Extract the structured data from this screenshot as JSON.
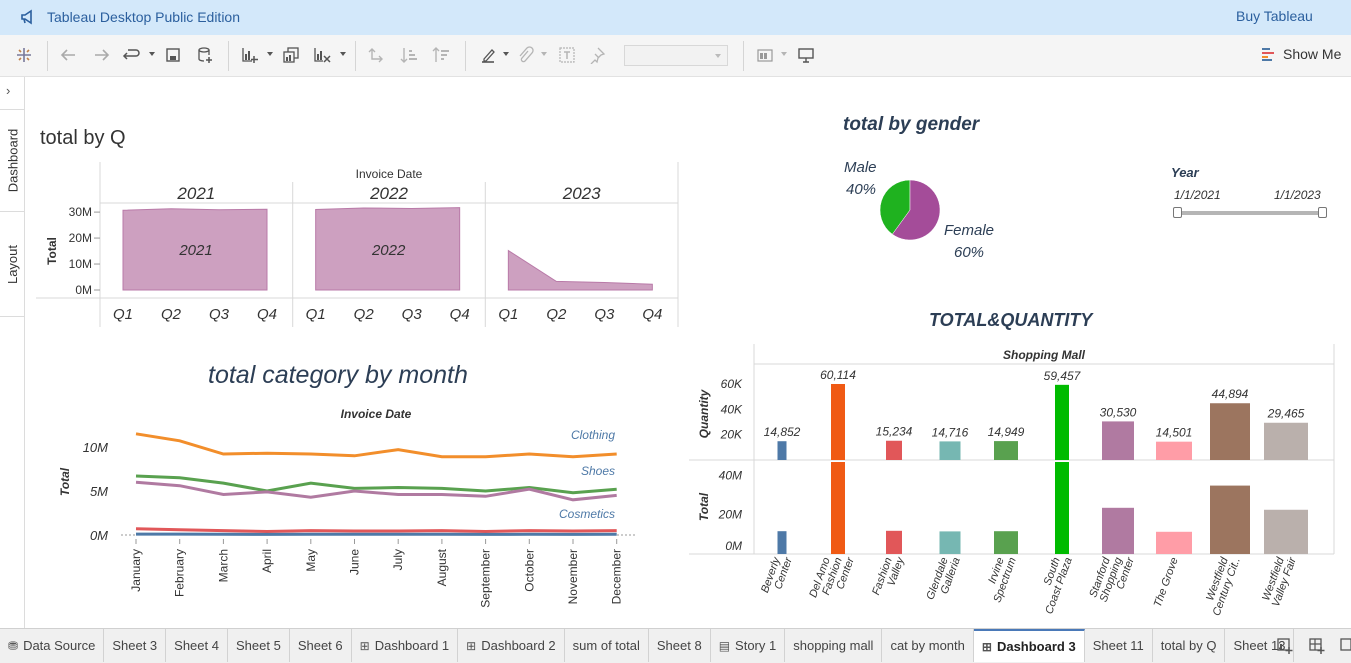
{
  "app": {
    "title": "Tableau Desktop Public Edition",
    "buy_label": "Buy Tableau"
  },
  "toolbar": {
    "show_me_label": "Show Me"
  },
  "side_panel": {
    "dashboard_label": "Dashboard",
    "layout_label": "Layout"
  },
  "sheets": {
    "total_by_q": {
      "title": "total by Q",
      "header": "Invoice Date",
      "ylabel": "Total",
      "panes": [
        "2021",
        "2022",
        "2023"
      ],
      "y_ticks": [
        "30M",
        "20M",
        "10M",
        "0M"
      ],
      "quarters": [
        "Q1",
        "Q2",
        "Q3",
        "Q4"
      ]
    },
    "gender": {
      "title": "total by gender",
      "male_label": "Male",
      "male_pct": "40%",
      "female_label": "Female",
      "female_pct": "60%"
    },
    "year_filter": {
      "title": "Year",
      "start": "1/1/2021",
      "end": "1/1/2023"
    },
    "category_month": {
      "title": "total category by month",
      "header": "Invoice Date",
      "ylabel": "Total",
      "y_ticks": [
        "10M",
        "5M",
        "0M"
      ]
    },
    "total_quantity": {
      "title": "TOTAL&QUANTITY",
      "header": "Shopping Mall",
      "quantity_label": "Quantity",
      "total_label": "Total",
      "qty_ticks": [
        "60K",
        "40K",
        "20K"
      ],
      "total_ticks": [
        "40M",
        "20M",
        "0M"
      ]
    }
  },
  "chart_data": [
    {
      "type": "area",
      "title": "total by Q",
      "ylabel": "Total",
      "xlabel": "Invoice Date",
      "ylim": [
        0,
        33000000
      ],
      "categories": [
        "Q1",
        "Q2",
        "Q3",
        "Q4"
      ],
      "series": [
        {
          "name": "2021",
          "color": "#c48fb5",
          "values": [
            30700000,
            31300000,
            30900000,
            31100000
          ]
        },
        {
          "name": "2022",
          "color": "#c48fb5",
          "values": [
            31000000,
            31600000,
            31400000,
            31700000
          ]
        },
        {
          "name": "2023",
          "color": "#c48fb5",
          "values": [
            15200000,
            3300000,
            2900000,
            2200000
          ]
        }
      ]
    },
    {
      "type": "pie",
      "title": "total by gender",
      "categories": [
        "Male",
        "Female"
      ],
      "values": [
        40,
        60
      ],
      "colors": [
        "#1fb21f",
        "#a44c99"
      ]
    },
    {
      "type": "line",
      "title": "total category by month",
      "xlabel": "Invoice Date",
      "ylabel": "Total",
      "ylim": [
        -300000,
        12200000
      ],
      "categories": [
        "January",
        "February",
        "March",
        "April",
        "May",
        "June",
        "July",
        "August",
        "September",
        "October",
        "November",
        "December"
      ],
      "series": [
        {
          "name": "Clothing",
          "color": "#f28e2b",
          "values": [
            11500000,
            10700000,
            9200000,
            9300000,
            9200000,
            9000000,
            9700000,
            8900000,
            8900000,
            9200000,
            8900000,
            9200000
          ]
        },
        {
          "name": "Shoes",
          "color": "#59a14f",
          "values": [
            6700000,
            6500000,
            5900000,
            5000000,
            5900000,
            5300000,
            5400000,
            5300000,
            5000000,
            5400000,
            4800000,
            5200000
          ]
        },
        {
          "name": "",
          "color": "#b07aa1",
          "values": [
            6000000,
            5600000,
            4600000,
            4900000,
            4300000,
            5000000,
            4600000,
            4600000,
            4400000,
            5200000,
            4000000,
            4500000
          ]
        },
        {
          "name": "Cosmetics",
          "color": "#e15759",
          "values": [
            700000,
            600000,
            500000,
            400000,
            500000,
            450000,
            450000,
            500000,
            400000,
            500000,
            450000,
            500000
          ]
        },
        {
          "name": "",
          "color": "#4e79a7",
          "values": [
            100000,
            100000,
            80000,
            70000,
            80000,
            80000,
            80000,
            80000,
            70000,
            80000,
            70000,
            80000
          ]
        }
      ]
    },
    {
      "type": "bar",
      "title": "TOTAL&QUANTITY",
      "xlabel": "Shopping Mall",
      "categories": [
        "Beverly Center",
        "Del Amo Fashion Center",
        "Fashion Valley",
        "Glendale Galleria",
        "Irvine Spectrum",
        "South Coast Plaza",
        "Stanford Shopping Center",
        "The Grove",
        "Westfield Century Cit..",
        "Westfield Valley Fair"
      ],
      "colors": [
        "#4e79a7",
        "#f05a14",
        "#e15759",
        "#76b7b2",
        "#59a14f",
        "#00bb00",
        "#b07aa1",
        "#ff9da7",
        "#9c755f",
        "#bab0ac"
      ],
      "series": [
        {
          "name": "Quantity",
          "values": [
            14852,
            60114,
            15234,
            14716,
            14949,
            59457,
            30530,
            14501,
            44894,
            29465
          ],
          "labels": [
            "14,852",
            "60,114",
            "15,234",
            "14,716",
            "14,949",
            "59,457",
            "30,530",
            "14,501",
            "44,894",
            "29,465"
          ],
          "ylim": [
            0,
            65000
          ]
        },
        {
          "name": "Total",
          "values": [
            11600000,
            46800000,
            11800000,
            11500000,
            11600000,
            46800000,
            23500000,
            11300000,
            34800000,
            22500000
          ],
          "ylim": [
            0,
            47000000
          ]
        }
      ]
    }
  ],
  "tabs": [
    {
      "label": "Data Source",
      "icon": "database-icon"
    },
    {
      "label": "Sheet 3"
    },
    {
      "label": "Sheet 4"
    },
    {
      "label": "Sheet 5"
    },
    {
      "label": "Sheet 6"
    },
    {
      "label": "Dashboard 1",
      "icon": "dashboard-icon"
    },
    {
      "label": "Dashboard 2",
      "icon": "dashboard-icon"
    },
    {
      "label": "sum of total"
    },
    {
      "label": "Sheet 8"
    },
    {
      "label": "Story 1",
      "icon": "story-icon"
    },
    {
      "label": "shopping mall"
    },
    {
      "label": "cat by month"
    },
    {
      "label": "Dashboard 3",
      "icon": "dashboard-icon",
      "active": true
    },
    {
      "label": "Sheet 11"
    },
    {
      "label": "total by Q"
    },
    {
      "label": "Sheet 13"
    }
  ]
}
